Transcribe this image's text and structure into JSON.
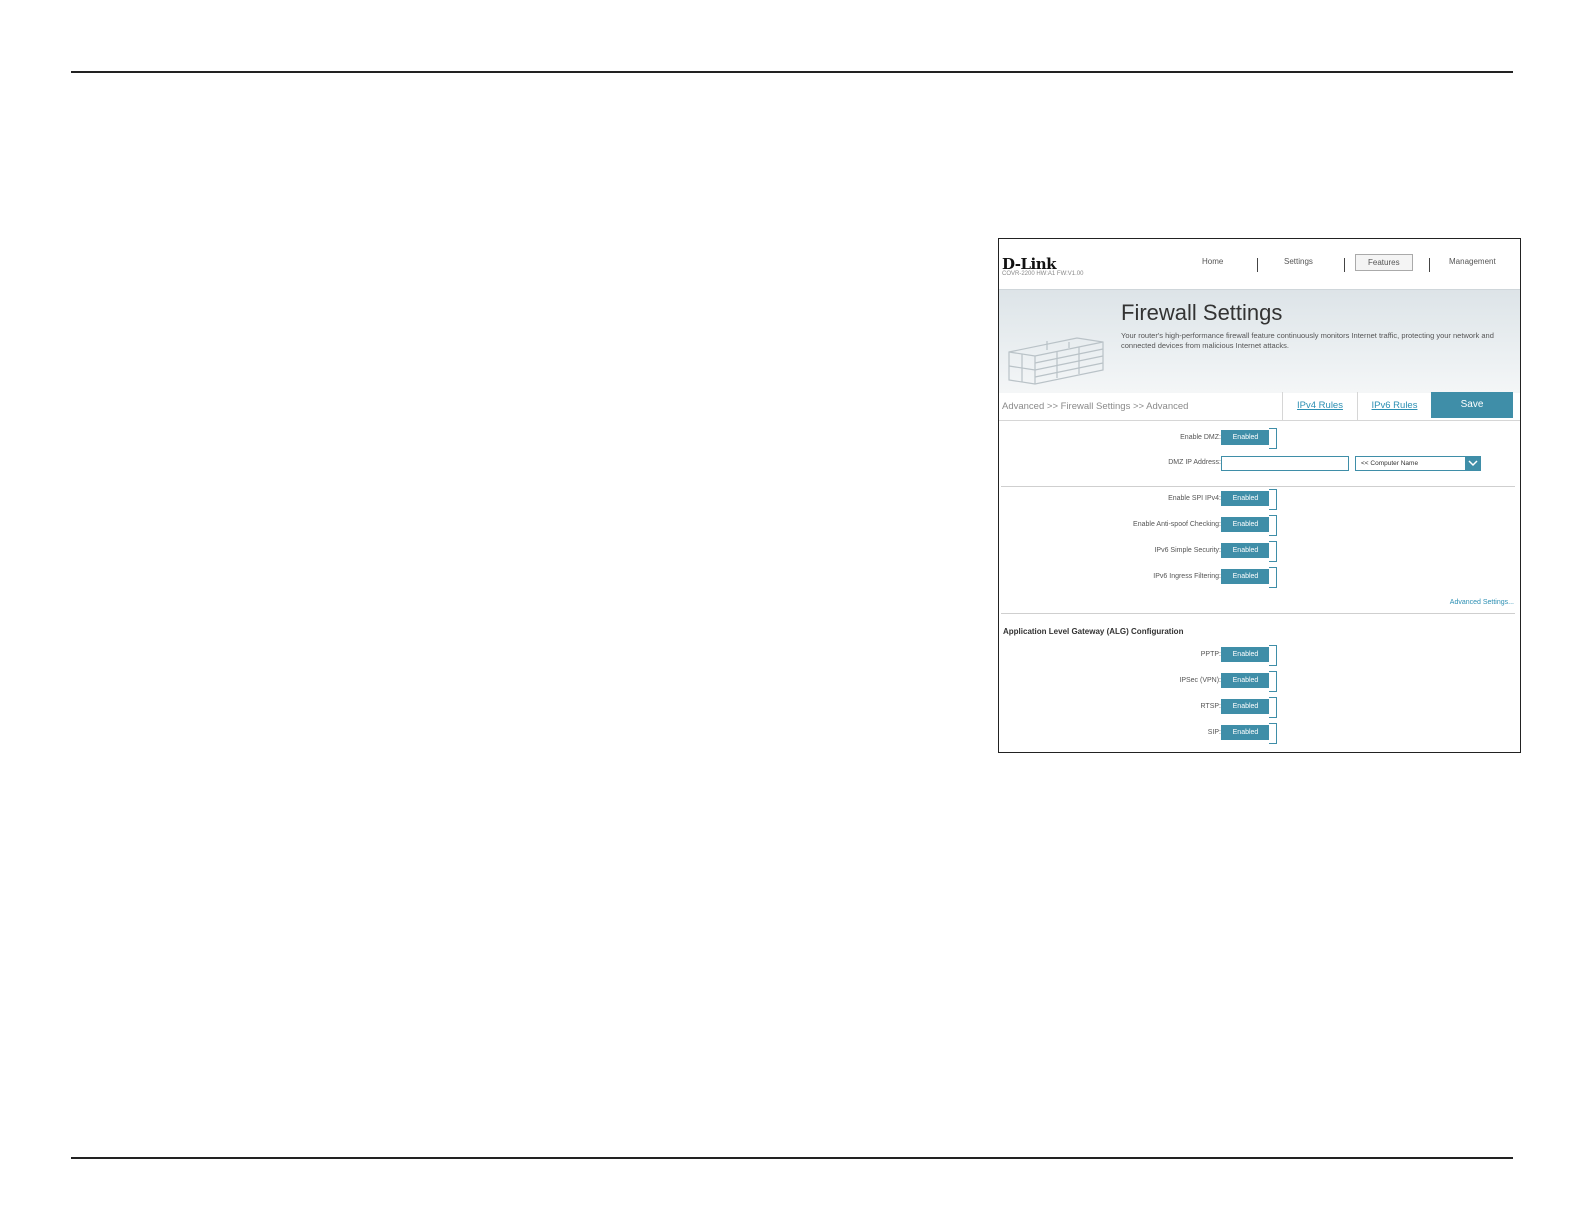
{
  "header": {
    "logo": "D-Link",
    "model": "COVR-2200 HW:A1 FW:V1.00",
    "nav": [
      "Home",
      "Settings",
      "Features",
      "Management"
    ],
    "active_nav": "Features"
  },
  "banner": {
    "title": "Firewall Settings",
    "description": "Your router's high-performance firewall feature continuously monitors Internet traffic, protecting your network and connected devices from malicious Internet attacks."
  },
  "toolbar": {
    "breadcrumb": "Advanced >> Firewall Settings >> Advanced",
    "ipv4_rules": "IPv4 Rules",
    "ipv6_rules": "IPv6 Rules",
    "save": "Save"
  },
  "dmz": {
    "enable_label": "Enable DMZ:",
    "enable_value": "Enabled",
    "ip_label": "DMZ IP Address:",
    "ip_value": "",
    "computer_select": "<< Computer Name"
  },
  "security": [
    {
      "label": "Enable SPI IPv4:",
      "value": "Enabled"
    },
    {
      "label": "Enable Anti-spoof Checking:",
      "value": "Enabled"
    },
    {
      "label": "IPv6 Simple Security:",
      "value": "Enabled"
    },
    {
      "label": "IPv6 Ingress Filtering:",
      "value": "Enabled"
    }
  ],
  "advanced_link": "Advanced Settings...",
  "alg": {
    "title": "Application Level Gateway (ALG) Configuration",
    "items": [
      {
        "label": "PPTP:",
        "value": "Enabled"
      },
      {
        "label": "IPSec (VPN):",
        "value": "Enabled"
      },
      {
        "label": "RTSP:",
        "value": "Enabled"
      },
      {
        "label": "SIP:",
        "value": "Enabled"
      }
    ]
  }
}
